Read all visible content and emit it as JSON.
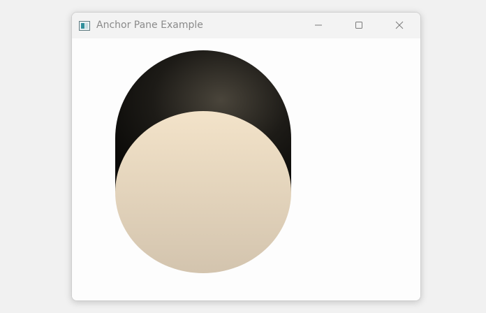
{
  "window": {
    "title": "Anchor Pane Example",
    "icon": "java-app-icon",
    "controls": [
      "minimize-icon",
      "maximize-icon",
      "close-icon"
    ]
  },
  "scene": {
    "shape": "cylinder",
    "colors": {
      "top_dark": "#0b0a08",
      "top_highlight": "#4a453b",
      "face_light": "#f3e3c9",
      "face_shadow": "#d3c4ae"
    }
  }
}
